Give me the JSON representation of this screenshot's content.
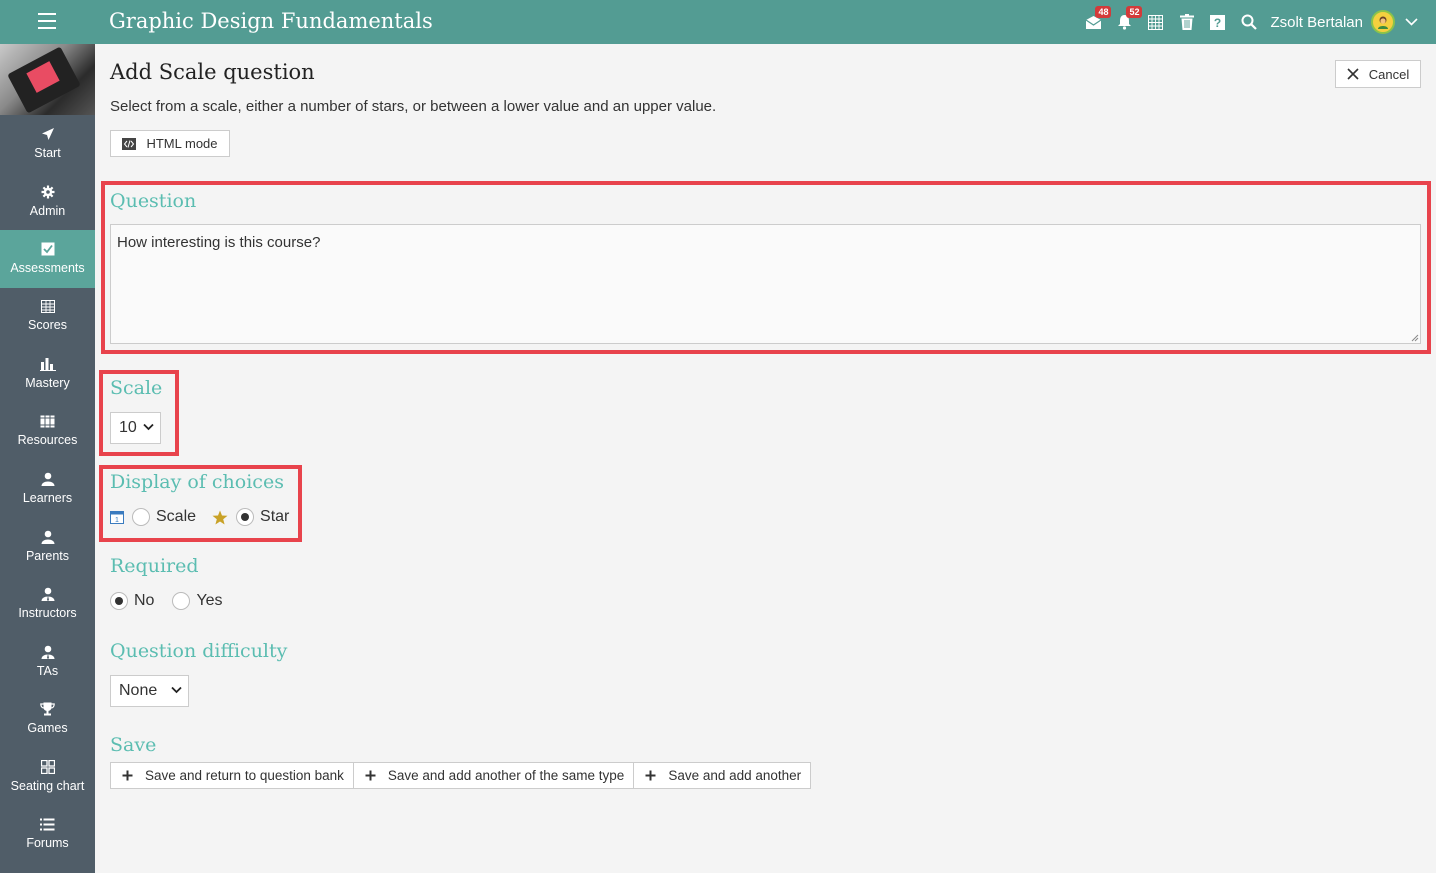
{
  "header": {
    "title": "Graphic Design Fundamentals",
    "messages_badge": "48",
    "notifications_badge": "52",
    "user_name": "Zsolt Bertalan"
  },
  "sidebar": {
    "items": [
      {
        "label": "Start",
        "icon": "send-icon"
      },
      {
        "label": "Admin",
        "icon": "gear-icon"
      },
      {
        "label": "Assessments",
        "icon": "checkbox-icon",
        "active": true
      },
      {
        "label": "Scores",
        "icon": "table-icon"
      },
      {
        "label": "Mastery",
        "icon": "bar-chart-icon"
      },
      {
        "label": "Resources",
        "icon": "books-icon"
      },
      {
        "label": "Learners",
        "icon": "user-icon"
      },
      {
        "label": "Parents",
        "icon": "user-icon"
      },
      {
        "label": "Instructors",
        "icon": "instructor-icon"
      },
      {
        "label": "TAs",
        "icon": "ta-icon"
      },
      {
        "label": "Games",
        "icon": "trophy-icon"
      },
      {
        "label": "Seating chart",
        "icon": "grid-icon"
      },
      {
        "label": "Forums",
        "icon": "list-icon"
      }
    ]
  },
  "page": {
    "title": "Add Scale question",
    "subtitle": "Select from a scale, either a number of stars, or between a lower value and an upper value.",
    "cancel_label": "Cancel",
    "html_mode_label": "HTML mode"
  },
  "question": {
    "label": "Question",
    "value": "How interesting is this course?"
  },
  "scale": {
    "label": "Scale",
    "selected": "10"
  },
  "display": {
    "label": "Display of choices",
    "options": [
      "Scale",
      "Star"
    ],
    "selected": "Star"
  },
  "required": {
    "label": "Required",
    "options": [
      "No",
      "Yes"
    ],
    "selected": "No"
  },
  "difficulty": {
    "label": "Question difficulty",
    "selected": "None"
  },
  "save": {
    "label": "Save",
    "buttons": [
      "Save and return to question bank",
      "Save and add another of the same type",
      "Save and add another"
    ]
  },
  "colors": {
    "topbar": "#539c93",
    "sidebar": "#505d68",
    "active_nav": "#5ba59b",
    "section_label": "#5bbdb1",
    "highlight_box": "#e8434c"
  }
}
